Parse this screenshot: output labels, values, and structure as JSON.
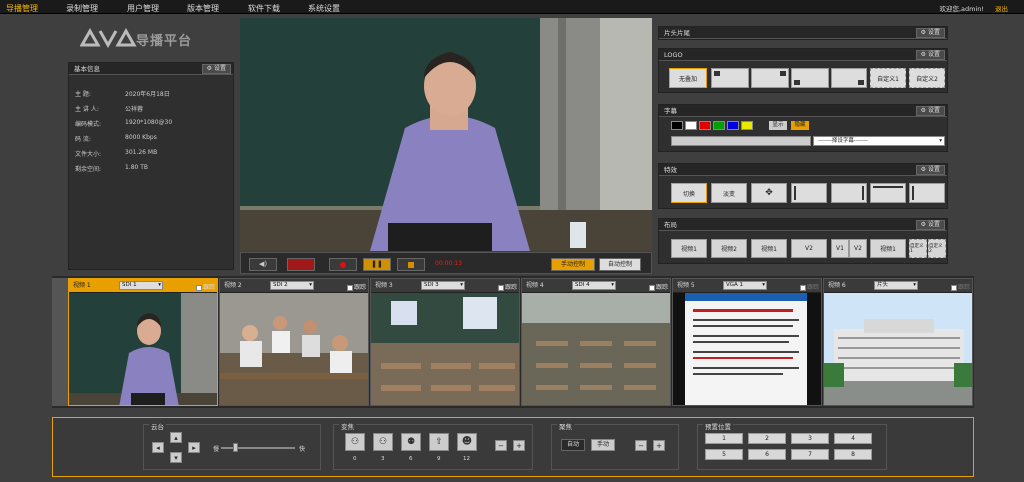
{
  "nav": {
    "items": [
      "导播管理",
      "录制管理",
      "用户管理",
      "版本管理",
      "软件下载",
      "系统设置"
    ],
    "user": "欢迎您,admin!",
    "logout": "退出"
  },
  "logo_text": "导播平台",
  "info": {
    "title": "基本信息",
    "settings": "设置",
    "rows": [
      {
        "label": "主  题:",
        "value": "2020年6月18日"
      },
      {
        "label": "主 讲 人:",
        "value": "公祥蓉"
      },
      {
        "label": "编码模式:",
        "value": "1920*1080@30"
      },
      {
        "label": "码  流:",
        "value": "8000 Kbps"
      },
      {
        "label": "文件大小:",
        "value": "301.26 MB"
      },
      {
        "label": "剩余空间:",
        "value": "1.80 TB"
      }
    ]
  },
  "controls": {
    "time": "00:00:13",
    "manual": "手动控制",
    "auto": "自动控制"
  },
  "right": {
    "header_clip": "片头片尾",
    "settings": "设置",
    "logo": {
      "title": "LOGO",
      "none": "无叠加",
      "custom1": "自定义1",
      "custom2": "自定义2"
    },
    "subtitle": {
      "title": "字幕",
      "show": "显示",
      "hide": "隐藏",
      "placeholder": "-------择设字幕-------",
      "colors": [
        "#000000",
        "#ffffff",
        "#e00000",
        "#00a000",
        "#0000e0",
        "#e8e800"
      ]
    },
    "effects": {
      "title": "特效",
      "cut": "切换",
      "fade": "淡变"
    },
    "layout": {
      "title": "布局",
      "buttons": [
        "视频1",
        "视频2",
        "视频1",
        "V2",
        "V1",
        "V2",
        "视频1",
        "自定义1",
        "自定义2"
      ]
    }
  },
  "cameras": [
    {
      "name": "视频 1",
      "source": "SDI 1",
      "follow": "跟踪",
      "active": true
    },
    {
      "name": "视频 2",
      "source": "SDI 2",
      "follow": "跟踪",
      "active": false
    },
    {
      "name": "视频 3",
      "source": "SDI 3",
      "follow": "跟踪",
      "active": false
    },
    {
      "name": "视频 4",
      "source": "SDI 4",
      "follow": "跟踪",
      "active": false
    },
    {
      "name": "视频 5",
      "source": "VGA 1",
      "follow": "跟踪",
      "active": false
    },
    {
      "name": "视频 6",
      "source": "片头",
      "follow": "跟踪",
      "active": false
    }
  ],
  "ptz": {
    "yuntai": "云台",
    "slow": "慢",
    "fast": "快",
    "view": "变焦",
    "view_counts": [
      "0",
      "3",
      "6",
      "9",
      "12"
    ],
    "focus": "聚焦",
    "auto": "自动",
    "manual": "手动",
    "preset": "预置位置",
    "presets": [
      "1",
      "2",
      "3",
      "4",
      "5",
      "6",
      "7",
      "8"
    ]
  }
}
